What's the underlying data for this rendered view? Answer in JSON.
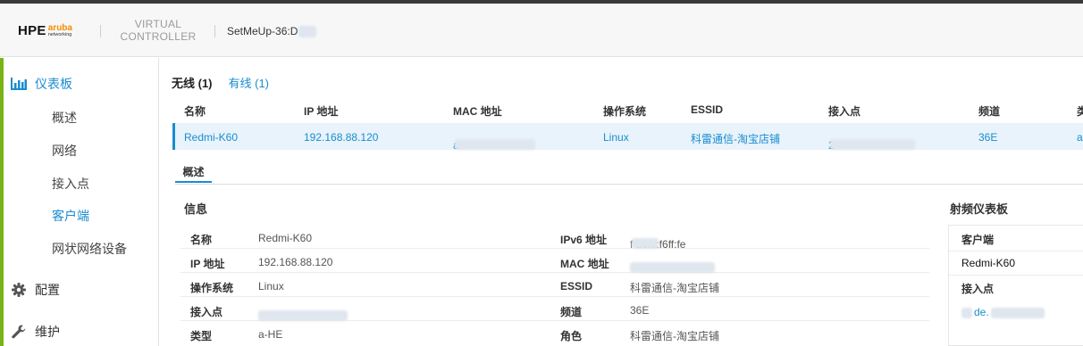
{
  "header": {
    "brand": "HPE",
    "brand_sub": "aruba",
    "brand_sub2": "networking",
    "product_line1": "VIRTUAL",
    "product_line2": "CONTROLLER",
    "device_name": "SetMeUp-36:D"
  },
  "sidebar": {
    "dashboard": "仪表板",
    "dashboard_items": [
      "概述",
      "网络",
      "接入点",
      "客户端",
      "网状网络设备"
    ],
    "active_item": "客户端",
    "config": "配置",
    "maintenance": "维护"
  },
  "tabs": {
    "wireless": "无线 (1)",
    "wired": "有线 (1)"
  },
  "table": {
    "headers": [
      "名称",
      "IP 地址",
      "MAC 地址",
      "操作系统",
      "ESSID",
      "接入点",
      "频道",
      "类"
    ],
    "row": [
      "Redmi-K60",
      "192.168.88.120",
      "a",
      "Linux",
      "科雷通信-淘宝店铺",
      "2",
      "36E",
      "a"
    ]
  },
  "subtab": "概述",
  "info": {
    "title": "信息",
    "left": [
      {
        "label": "名称",
        "value": "Redmi-K60"
      },
      {
        "label": "IP 地址",
        "value": "192.168.88.120"
      },
      {
        "label": "操作系统",
        "value": "Linux"
      },
      {
        "label": "接入点",
        "value": ""
      },
      {
        "label": "类型",
        "value": "a-HE"
      }
    ],
    "right": [
      {
        "label": "IPv6 地址",
        "value": "f     a0fc:f6ff:fe"
      },
      {
        "label": "MAC 地址",
        "value": ""
      },
      {
        "label": "ESSID",
        "value": "科雷通信-淘宝店铺"
      },
      {
        "label": "频道",
        "value": "36E"
      },
      {
        "label": "角色",
        "value": "科雷通信-淘宝店铺"
      }
    ]
  },
  "rf_dashboard": {
    "title": "射频仪表板",
    "client_label": "客户端",
    "client_value": "Redmi-K60",
    "ap_label": "接入点",
    "ap_value": "de."
  },
  "colors": {
    "accent": "#1a8ccf",
    "sidebar_strip": "#7ab317",
    "aruba_orange": "#f28c00"
  }
}
